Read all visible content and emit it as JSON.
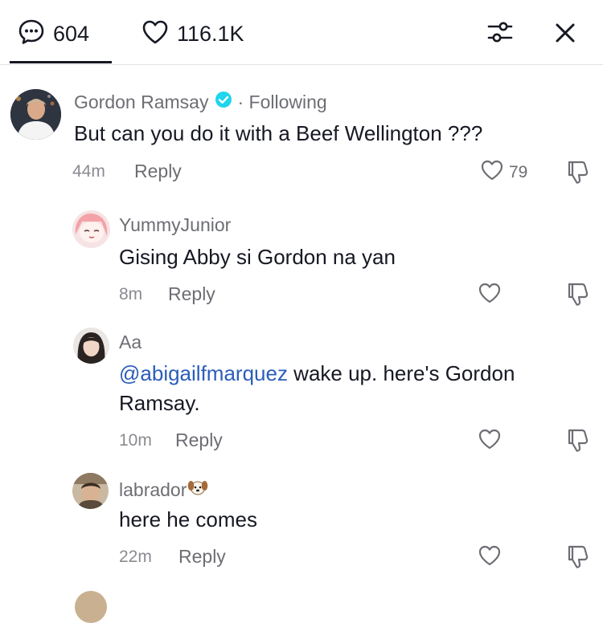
{
  "header": {
    "comment_count": "604",
    "like_count": "116.1K",
    "icons": {
      "comments": "chat-bubble-icon",
      "likes": "heart-outline-icon",
      "filter": "sliders-icon",
      "close": "close-icon"
    }
  },
  "comments": [
    {
      "username": "Gordon Ramsay",
      "following": "· Following",
      "text": "But can you do it with a Beef Wellington ???",
      "time": "44m",
      "reply": "Reply",
      "likes": "79"
    },
    {
      "username": "YummyJunior",
      "text": "Gising Abby si Gordon na yan",
      "time": "8m",
      "reply": "Reply"
    },
    {
      "username": "Aa",
      "mention": "@abigailfmarquez",
      "text_line1": " wake up. here's Gordon",
      "text_line2": "Ramsay.",
      "time": "10m",
      "reply": "Reply"
    },
    {
      "username": "labrador",
      "text": "here he comes",
      "time": "22m",
      "reply": "Reply"
    }
  ],
  "colors": {
    "text": "#161823",
    "secondary": "#6d6e74",
    "mention": "#2b5db9",
    "verified": "#20d5ec"
  }
}
